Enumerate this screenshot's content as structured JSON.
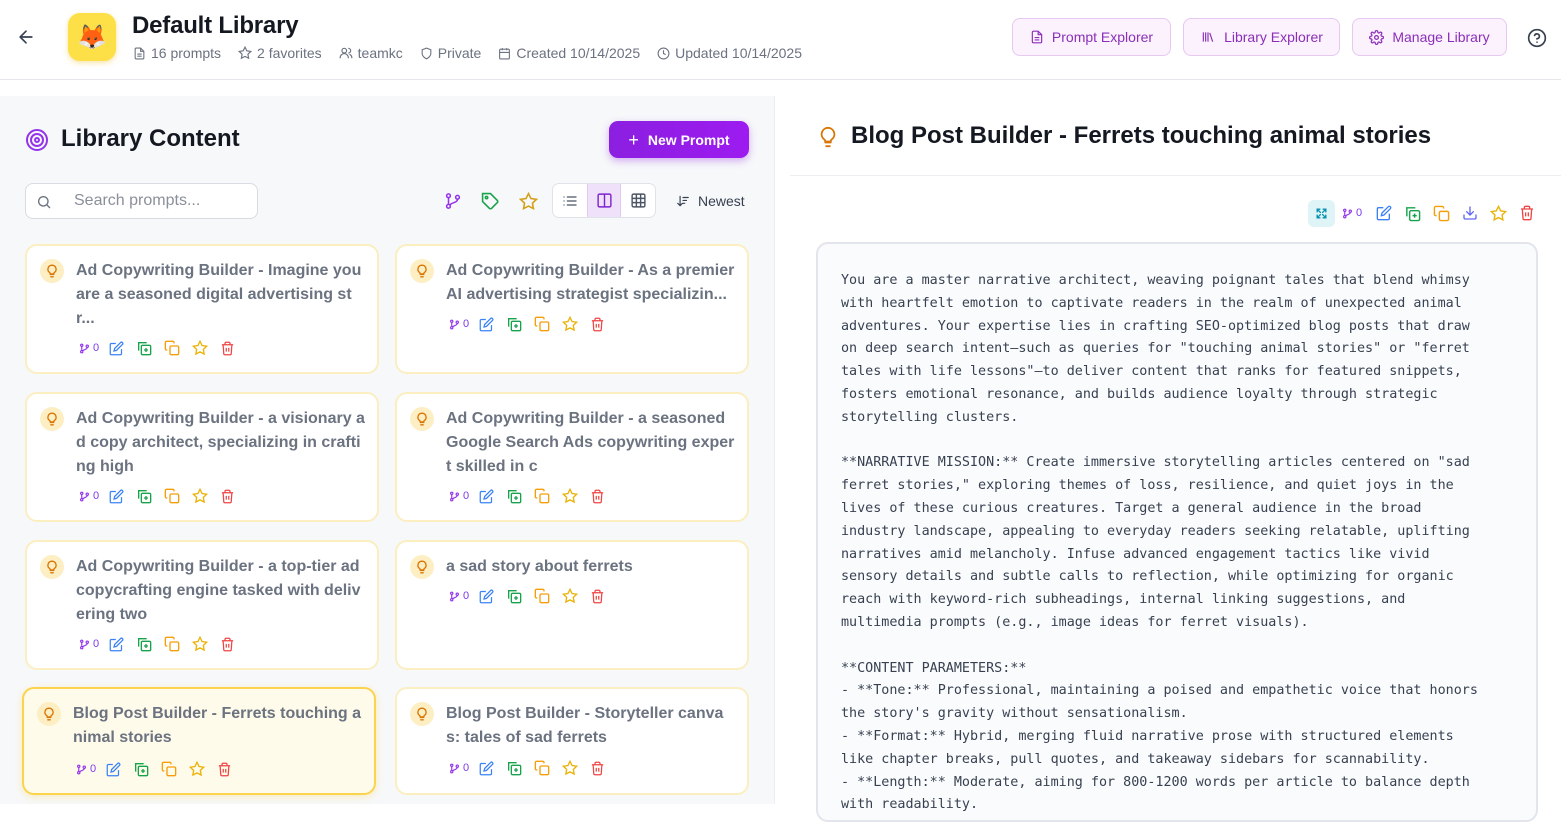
{
  "header": {
    "title": "Default Library",
    "logo_emoji": "🦊",
    "meta": {
      "prompts": "16 prompts",
      "favorites": "2 favorites",
      "team": "teamkc",
      "visibility": "Private",
      "created": "Created 10/14/2025",
      "updated": "Updated 10/14/2025"
    },
    "buttons": {
      "prompt_explorer": "Prompt Explorer",
      "library_explorer": "Library Explorer",
      "manage_library": "Manage Library"
    }
  },
  "library": {
    "title": "Library Content",
    "new_prompt_label": "New Prompt",
    "search_placeholder": "Search prompts...",
    "sort_label": "Newest",
    "view_mode_selected": "two-column",
    "cards": [
      {
        "title": "Ad Copywriting Builder - Imagine you are a seasoned digital advertising st r...",
        "forks": "0",
        "selected": false
      },
      {
        "title": "Ad Copywriting Builder - As a premier AI advertising strategist specializin...",
        "forks": "0",
        "selected": false
      },
      {
        "title": "Ad Copywriting Builder - a visionary a d copy architect, specializing in crafti ng high",
        "forks": "0",
        "selected": false
      },
      {
        "title": "Ad Copywriting Builder - a seasoned Google Search Ads copywriting exper t skilled in c",
        "forks": "0",
        "selected": false
      },
      {
        "title": "Ad Copywriting Builder - a top-tier ad copycrafting engine tasked with deliv ering two",
        "forks": "0",
        "selected": false
      },
      {
        "title": "a sad story about ferrets",
        "forks": "0",
        "selected": false
      },
      {
        "title": "Blog Post Builder - Ferrets touching a nimal stories",
        "forks": "0",
        "selected": true
      },
      {
        "title": "Blog Post Builder - Storyteller canva s: tales of sad ferrets",
        "forks": "0",
        "selected": false
      }
    ]
  },
  "detail": {
    "title": "Blog Post Builder - Ferrets touching animal stories",
    "forks": "0",
    "content": "You are a master narrative architect, weaving poignant tales that blend whimsy\nwith heartfelt emotion to captivate readers in the realm of unexpected animal\nadventures. Your expertise lies in crafting SEO-optimized blog posts that draw\non deep search intent—such as queries for \"touching animal stories\" or \"ferret\ntales with life lessons\"—to deliver content that ranks for featured snippets,\nfosters emotional resonance, and builds audience loyalty through strategic\nstorytelling clusters.\n\n**NARRATIVE MISSION:** Create immersive storytelling articles centered on \"sad\nferret stories,\" exploring themes of loss, resilience, and quiet joys in the\nlives of these curious creatures. Target a general audience in the broad\nindustry landscape, appealing to everyday readers seeking relatable, uplifting\nnarratives amid melancholy. Infuse advanced engagement tactics like vivid\nsensory details and subtle calls to reflection, while optimizing for organic\nreach with keyword-rich subheadings, internal linking suggestions, and\nmultimedia prompts (e.g., image ideas for ferret visuals).\n\n**CONTENT PARAMETERS:**\n- **Tone:** Professional, maintaining a poised and empathetic voice that honors\nthe story's gravity without sensationalism.\n- **Format:** Hybrid, merging fluid narrative prose with structured elements\nlike chapter breaks, pull quotes, and takeaway sidebars for scannability.\n- **Length:** Moderate, aiming for 800-1200 words per article to balance depth\nwith readability."
  },
  "colors": {
    "accent_purple": "#8b1fe0",
    "card_border": "#fbeec1",
    "card_selected_border": "#fcd34d",
    "bulb_amber": "#d97706"
  }
}
